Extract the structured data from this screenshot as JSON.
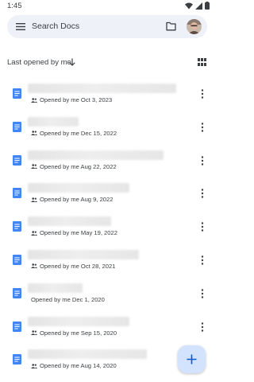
{
  "status_bar": {
    "time": "1:45",
    "icons": [
      "wifi-icon",
      "signal-icon",
      "battery-icon"
    ]
  },
  "search": {
    "placeholder": "Search Docs",
    "icons": [
      "menu-icon",
      "folder-icon",
      "avatar"
    ]
  },
  "sort": {
    "label": "Last opened by me",
    "direction_icon": "arrow-down-icon",
    "view_icon": "grid-view-icon"
  },
  "documents": [
    {
      "meta": "Opened by me Oct 3, 2023",
      "shared": true
    },
    {
      "meta": "Opened by me Dec 15, 2022",
      "shared": true
    },
    {
      "meta": "Opened by me Aug 22, 2022",
      "shared": true
    },
    {
      "meta": "Opened by me Aug 9, 2022",
      "shared": true
    },
    {
      "meta": "Opened by me May 19, 2022",
      "shared": true
    },
    {
      "meta": "Opened by me Oct 28, 2021",
      "shared": true
    },
    {
      "meta": "Opened by me Dec 1, 2020",
      "shared": false
    },
    {
      "meta": "Opened by me Sep 15, 2020",
      "shared": true
    },
    {
      "meta": "Opened by me Aug 14, 2020",
      "shared": true
    }
  ],
  "fab": {
    "icon": "plus-icon"
  },
  "colors": {
    "search_bg": "#eef1f8",
    "doc_blue": "#4285f4",
    "fab_bg": "#d3e3fd",
    "fab_plus": "#0b57d0"
  }
}
